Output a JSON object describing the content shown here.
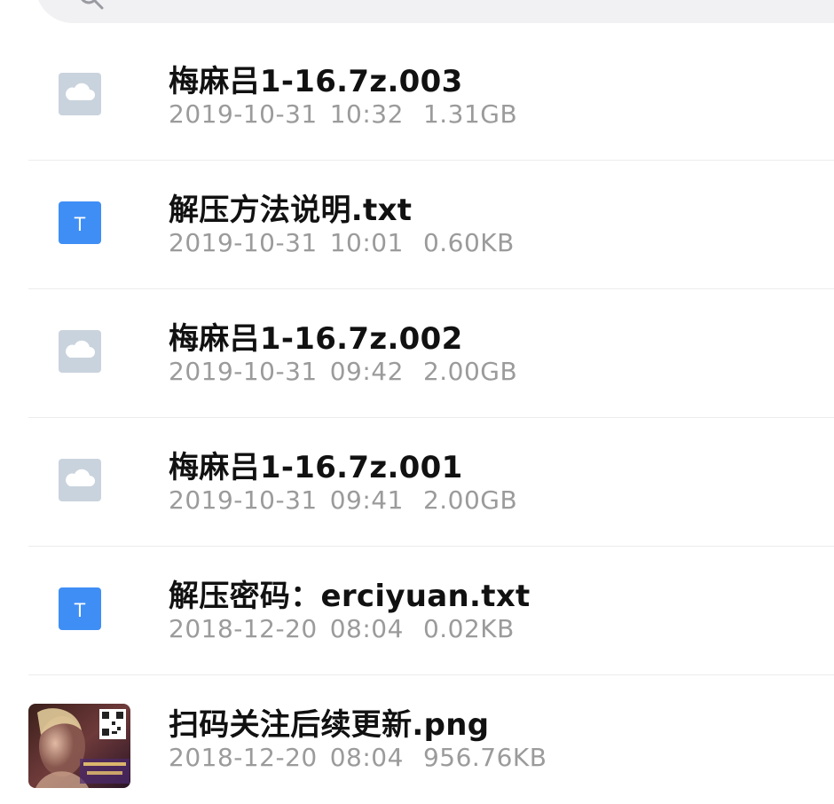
{
  "colors": {
    "cloud_icon_bg": "#c9d3dd",
    "text_icon_bg": "#3f8ef5",
    "name_text": "#111111",
    "meta_text": "#9b9b9b",
    "divider": "#ececec",
    "search_bg": "#f1f1f3"
  },
  "search": {
    "icon": "search-icon",
    "text": ""
  },
  "files": [
    {
      "name": "梅麻吕1-16.7z.003",
      "date": "2019-10-31",
      "time": "10:32",
      "size": "1.31GB",
      "icon": "cloud-file-icon",
      "type": "archive"
    },
    {
      "name": "解压方法说明.txt",
      "date": "2019-10-31",
      "time": "10:01",
      "size": "0.60KB",
      "icon": "text-file-icon",
      "icon_letter": "T",
      "type": "text"
    },
    {
      "name": "梅麻吕1-16.7z.002",
      "date": "2019-10-31",
      "time": "09:42",
      "size": "2.00GB",
      "icon": "cloud-file-icon",
      "type": "archive"
    },
    {
      "name": "梅麻吕1-16.7z.001",
      "date": "2019-10-31",
      "time": "09:41",
      "size": "2.00GB",
      "icon": "cloud-file-icon",
      "type": "archive"
    },
    {
      "name": "解压密码：erciyuan.txt",
      "date": "2018-12-20",
      "time": "08:04",
      "size": "0.02KB",
      "icon": "text-file-icon",
      "icon_letter": "T",
      "type": "text"
    },
    {
      "name": "扫码关注后续更新.png",
      "date": "2018-12-20",
      "time": "08:04",
      "size": "956.76KB",
      "icon": "image-thumbnail",
      "type": "image"
    }
  ]
}
